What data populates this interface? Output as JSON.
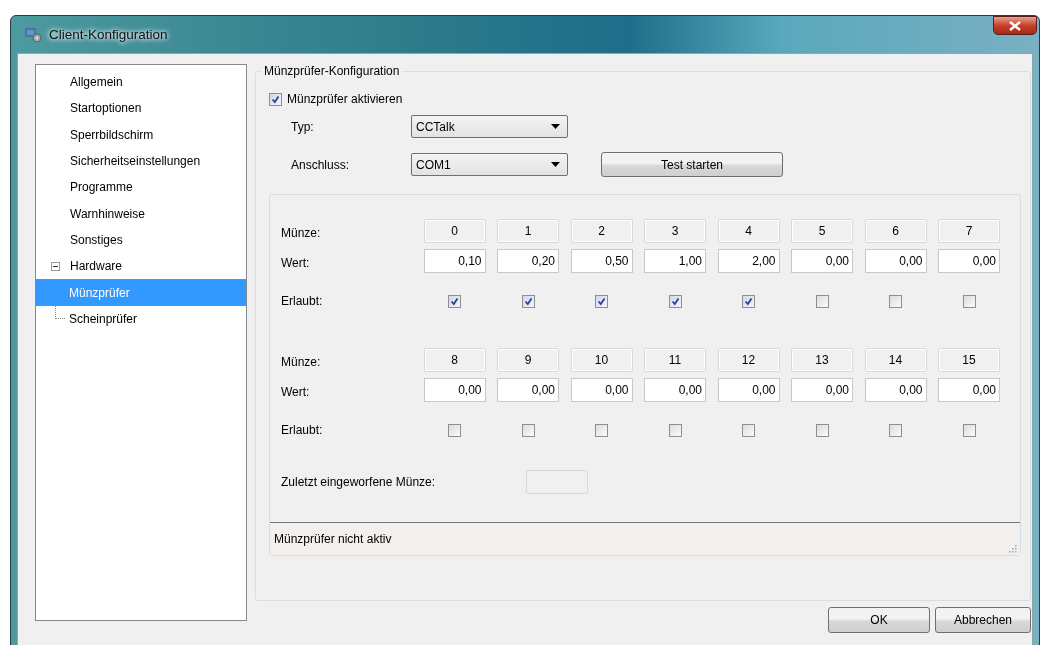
{
  "window": {
    "title": "Client-Konfiguration"
  },
  "sidebar": {
    "items": [
      {
        "label": "Allgemein",
        "selected": false
      },
      {
        "label": "Startoptionen",
        "selected": false
      },
      {
        "label": "Sperrbildschirm",
        "selected": false
      },
      {
        "label": "Sicherheitseinstellungen",
        "selected": false
      },
      {
        "label": "Programme",
        "selected": false
      },
      {
        "label": "Warnhinweise",
        "selected": false
      },
      {
        "label": "Sonstiges",
        "selected": false
      },
      {
        "label": "Hardware",
        "selected": false,
        "expanded": true,
        "children": [
          {
            "label": "Münzprüfer",
            "selected": true
          },
          {
            "label": "Scheinprüfer",
            "selected": false
          }
        ]
      }
    ]
  },
  "group": {
    "title": "Münzprüfer-Konfiguration",
    "activate": {
      "label": "Münzprüfer aktivieren",
      "checked": true
    },
    "fields": [
      {
        "label": "Typ:",
        "value": "CCTalk"
      },
      {
        "label": "Anschluss:",
        "value": "COM1"
      }
    ],
    "test_button": "Test starten",
    "coin_groups": [
      {
        "coin_label": "Münze:",
        "value_label": "Wert:",
        "allowed_label": "Erlaubt:",
        "coins": [
          {
            "number": "0",
            "value": "0,10",
            "allowed": true
          },
          {
            "number": "1",
            "value": "0,20",
            "allowed": true
          },
          {
            "number": "2",
            "value": "0,50",
            "allowed": true
          },
          {
            "number": "3",
            "value": "1,00",
            "allowed": true
          },
          {
            "number": "4",
            "value": "2,00",
            "allowed": true
          },
          {
            "number": "5",
            "value": "0,00",
            "allowed": false
          },
          {
            "number": "6",
            "value": "0,00",
            "allowed": false
          },
          {
            "number": "7",
            "value": "0,00",
            "allowed": false
          }
        ]
      },
      {
        "coin_label": "Münze:",
        "value_label": "Wert:",
        "allowed_label": "Erlaubt:",
        "coins": [
          {
            "number": "8",
            "value": "0,00",
            "allowed": false
          },
          {
            "number": "9",
            "value": "0,00",
            "allowed": false
          },
          {
            "number": "10",
            "value": "0,00",
            "allowed": false
          },
          {
            "number": "11",
            "value": "0,00",
            "allowed": false
          },
          {
            "number": "12",
            "value": "0,00",
            "allowed": false
          },
          {
            "number": "13",
            "value": "0,00",
            "allowed": false
          },
          {
            "number": "14",
            "value": "0,00",
            "allowed": false
          },
          {
            "number": "15",
            "value": "0,00",
            "allowed": false
          }
        ]
      }
    ],
    "last_coin": {
      "label": "Zuletzt eingeworfene Münze:"
    },
    "status_bar": "Münzprüfer nicht aktiv"
  },
  "buttons": [
    {
      "label": "OK"
    },
    {
      "label": "Abbrechen"
    }
  ]
}
